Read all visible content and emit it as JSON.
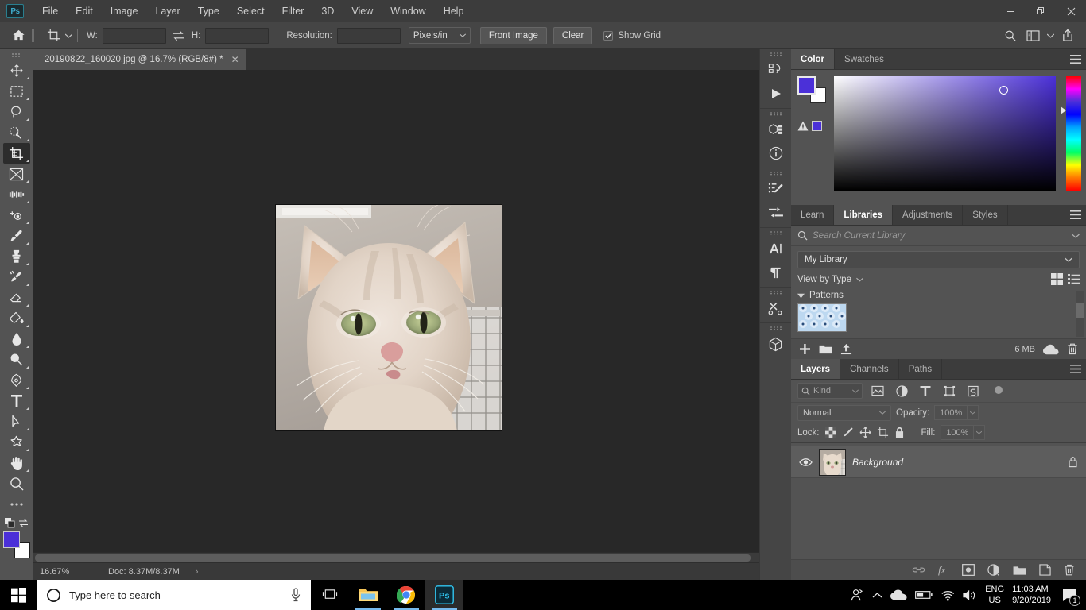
{
  "app": {
    "name": "Adobe Photoshop",
    "logo_text": "Ps"
  },
  "menubar": {
    "items": [
      {
        "label": "File"
      },
      {
        "label": "Edit"
      },
      {
        "label": "Image"
      },
      {
        "label": "Layer"
      },
      {
        "label": "Type"
      },
      {
        "label": "Select"
      },
      {
        "label": "Filter"
      },
      {
        "label": "3D"
      },
      {
        "label": "View"
      },
      {
        "label": "Window"
      },
      {
        "label": "Help"
      }
    ],
    "window_controls": {
      "minimize": "minimize-icon",
      "restore": "restore-icon",
      "close": "close-icon"
    }
  },
  "options_bar": {
    "home_icon": "home-icon",
    "tool_icon": "crop-tool-icon",
    "tool_preset_chevron": "chevron-down-icon",
    "width_label": "W:",
    "width_value": "",
    "width_placeholder": "",
    "swap_icon": "swap-width-height-icon",
    "height_label": "H:",
    "height_value": "",
    "height_placeholder": "",
    "resolution_label": "Resolution:",
    "resolution_value": "",
    "resolution_placeholder": "",
    "units_value": "Pixels/in",
    "front_image_label": "Front Image",
    "clear_label": "Clear",
    "show_grid_label": "Show Grid",
    "show_grid_checked": true,
    "right_icons": [
      "search-icon",
      "workspace-icon",
      "chevron-down-icon",
      "share-icon"
    ]
  },
  "document_tab": {
    "title": "20190822_160020.jpg @ 16.7% (RGB/8#) *",
    "close_icon": "close-icon"
  },
  "toolbar": {
    "tools": [
      {
        "name": "move-tool",
        "active": false
      },
      {
        "name": "rectangular-marquee-tool",
        "active": false
      },
      {
        "name": "lasso-tool",
        "active": false
      },
      {
        "name": "quick-selection-tool",
        "active": false
      },
      {
        "name": "crop-tool",
        "active": true
      },
      {
        "name": "frame-tool",
        "active": false
      },
      {
        "name": "eyedropper-tool",
        "active": false
      },
      {
        "name": "spot-healing-brush-tool",
        "active": false
      },
      {
        "name": "brush-tool",
        "active": false
      },
      {
        "name": "clone-stamp-tool",
        "active": false
      },
      {
        "name": "history-brush-tool",
        "active": false
      },
      {
        "name": "eraser-tool",
        "active": false
      },
      {
        "name": "gradient-tool",
        "active": false
      },
      {
        "name": "blur-tool",
        "active": false
      },
      {
        "name": "dodge-tool",
        "active": false
      },
      {
        "name": "pen-tool",
        "active": false
      },
      {
        "name": "type-tool",
        "active": false
      },
      {
        "name": "path-selection-tool",
        "active": false
      },
      {
        "name": "shape-tool",
        "active": false
      },
      {
        "name": "hand-tool",
        "active": false
      },
      {
        "name": "zoom-tool",
        "active": false
      },
      {
        "name": "edit-toolbar-tool",
        "active": false
      }
    ],
    "foreground_color": "#4b30d8",
    "background_color": "#ffffff"
  },
  "canvas": {
    "background_color": "#282828",
    "image_alt": "cream tabby cat portrait"
  },
  "status_bar": {
    "zoom": "16.67%",
    "doc_info": "Doc: 8.37M/8.37M",
    "arrow_icon": "chevron-right-icon"
  },
  "icon_dock": {
    "items": [
      {
        "name": "history-panel-icon"
      },
      {
        "name": "actions-panel-icon"
      },
      {
        "name": "3d-panel-icon"
      },
      {
        "name": "info-panel-icon"
      },
      {
        "name": "brush-settings-panel-icon"
      },
      {
        "name": "adjustments-presets-panel-icon"
      },
      {
        "name": "character-panel-icon"
      },
      {
        "name": "paragraph-panel-icon"
      },
      {
        "name": "tool-presets-panel-icon"
      },
      {
        "name": "3d-object-panel-icon"
      }
    ]
  },
  "color_panel": {
    "tabs": [
      {
        "label": "Color",
        "active": true
      },
      {
        "label": "Swatches",
        "active": false
      }
    ],
    "menu_icon": "panel-menu-icon",
    "foreground_color": "#4b30d8",
    "background_color": "#ffffff",
    "out_of_gamut_icon": "gamut-warning-icon",
    "gamut_swatch_color": "#4b30d8"
  },
  "libraries_panel": {
    "tabs": [
      {
        "label": "Learn",
        "active": false
      },
      {
        "label": "Libraries",
        "active": true
      },
      {
        "label": "Adjustments",
        "active": false
      },
      {
        "label": "Styles",
        "active": false
      }
    ],
    "menu_icon": "panel-menu-icon",
    "search_placeholder": "Search Current Library",
    "search_value": "",
    "search_icon": "search-icon",
    "search_chevron": "chevron-down-icon",
    "library_selected": "My Library",
    "view_by_label": "View by Type",
    "view_grid_icon": "grid-view-icon",
    "view_list_icon": "list-view-icon",
    "group_label": "Patterns",
    "group_expanded": true,
    "asset_name": "pattern-thumbnail",
    "footer": {
      "add_icon": "add-content-icon",
      "folder_icon": "new-group-icon",
      "upload_icon": "upload-icon",
      "size_label": "6 MB",
      "cloud_icon": "cloud-sync-icon",
      "delete_icon": "trash-icon"
    }
  },
  "layers_panel": {
    "tabs": [
      {
        "label": "Layers",
        "active": true
      },
      {
        "label": "Channels",
        "active": false
      },
      {
        "label": "Paths",
        "active": false
      }
    ],
    "menu_icon": "panel-menu-icon",
    "filter_kind_label": "Kind",
    "filter_icons": [
      "filter-pixel-icon",
      "filter-adjustment-icon",
      "filter-type-icon",
      "filter-shape-icon",
      "filter-smart-object-icon"
    ],
    "filter_toggle_icon": "filter-toggle-icon",
    "blend_mode": "Normal",
    "opacity_label": "Opacity:",
    "opacity_value": "100%",
    "lock_label": "Lock:",
    "lock_icons": [
      "lock-transparent-pixels-icon",
      "lock-image-pixels-icon",
      "lock-position-icon",
      "lock-artboard-icon",
      "lock-all-icon"
    ],
    "fill_label": "Fill:",
    "fill_value": "100%",
    "layers": [
      {
        "name": "Background",
        "visible": true,
        "locked": true,
        "visibility_icon": "eye-icon",
        "lock_icon": "lock-icon",
        "thumbnail": "cat-layer-thumbnail"
      }
    ],
    "footer_icons": [
      "link-layers-icon",
      "layer-style-fx-icon",
      "layer-mask-icon",
      "adjustment-layer-icon",
      "new-group-icon",
      "new-layer-icon",
      "delete-layer-icon"
    ]
  },
  "taskbar": {
    "start_icon": "windows-start-icon",
    "search_icon": "search-circle-icon",
    "search_placeholder": "Type here to search",
    "mic_icon": "microphone-icon",
    "task_view_icon": "task-view-icon",
    "pinned": [
      {
        "name": "file-explorer-icon",
        "open": true
      },
      {
        "name": "google-chrome-icon",
        "open": true
      },
      {
        "name": "photoshop-icon",
        "open": true,
        "active": true
      }
    ],
    "tray": {
      "people_icon": "people-icon",
      "show_hidden_icon": "chevron-up-icon",
      "onedrive_icon": "onedrive-cloud-icon",
      "battery_icon": "battery-icon",
      "wifi_icon": "wifi-icon",
      "volume_icon": "speaker-icon",
      "language_line1": "ENG",
      "language_line2": "US",
      "time": "11:03 AM",
      "date": "9/20/2019",
      "notification_icon": "notification-icon",
      "notification_count": "1"
    }
  }
}
